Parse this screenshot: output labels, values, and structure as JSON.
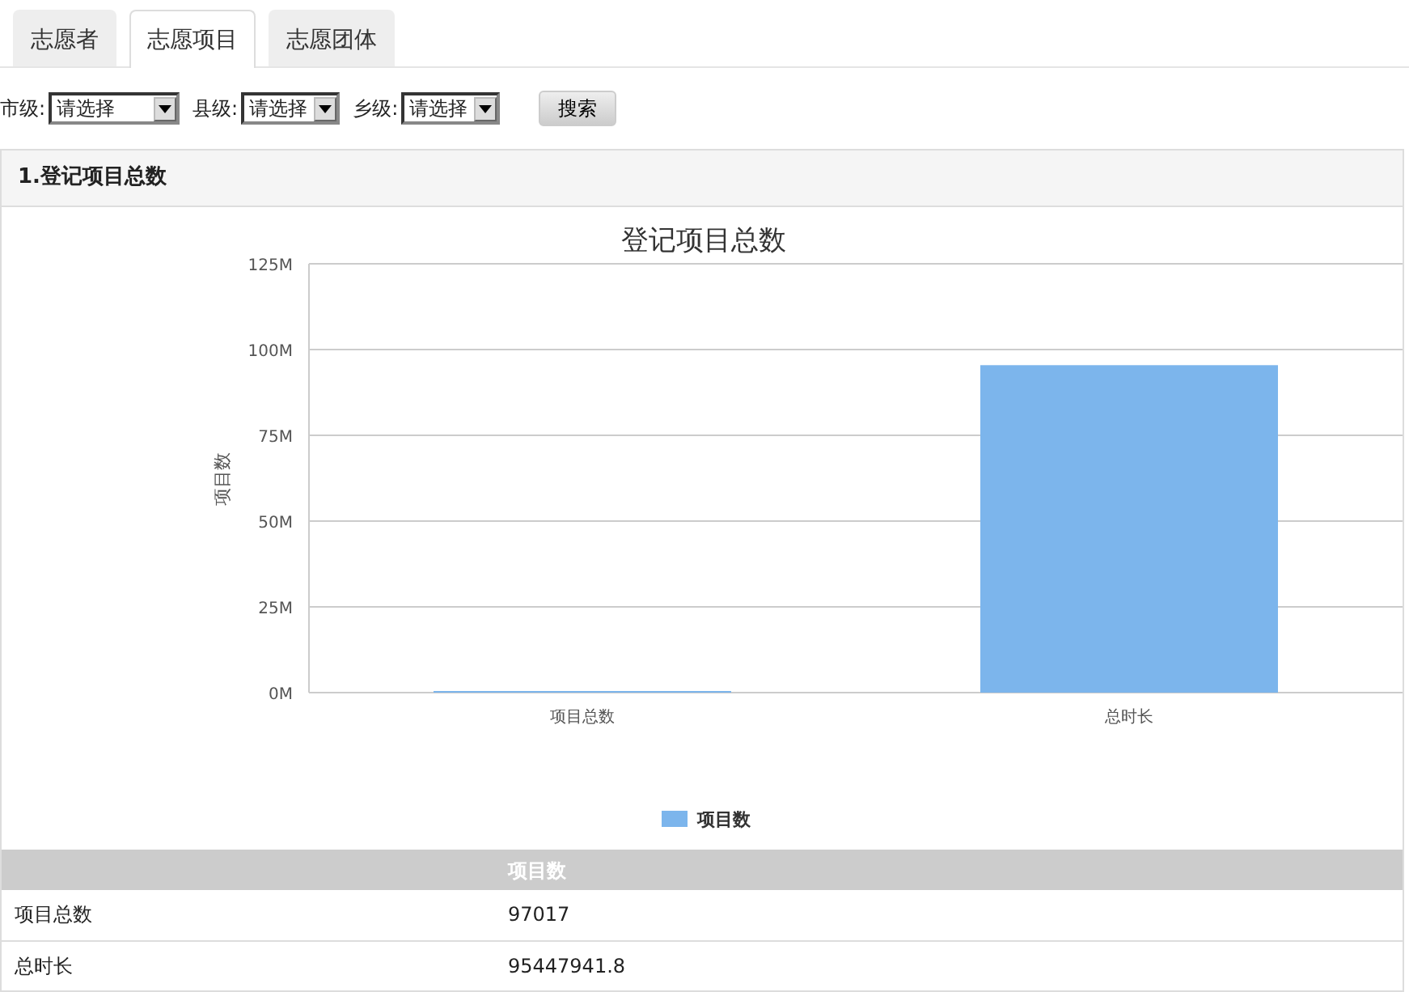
{
  "tabs": [
    {
      "label": "志愿者",
      "selected": false
    },
    {
      "label": "志愿项目",
      "selected": true
    },
    {
      "label": "志愿团体",
      "selected": false
    }
  ],
  "filters": [
    {
      "label": "市级:",
      "value": "请选择"
    },
    {
      "label": "县级:",
      "value": "请选择"
    },
    {
      "label": "乡级:",
      "value": "请选择"
    }
  ],
  "search_button": "搜索",
  "panel": {
    "title": "1.登记项目总数",
    "chart_data": {
      "type": "bar",
      "title": "登记项目总数",
      "ylabel": "项目数",
      "categories": [
        "项目总数",
        "总时长"
      ],
      "series": [
        {
          "name": "项目数",
          "color": "#7cb5ec",
          "values": [
            97017,
            95447941.8
          ]
        }
      ],
      "ylim": [
        0,
        125000000
      ],
      "grid": true,
      "yticks": [
        {
          "value": 0,
          "label": "0M"
        },
        {
          "value": 25000000,
          "label": "25M"
        },
        {
          "value": 50000000,
          "label": "50M"
        },
        {
          "value": 75000000,
          "label": "75M"
        },
        {
          "value": 100000000,
          "label": "100M"
        },
        {
          "value": 125000000,
          "label": "125M"
        }
      ]
    },
    "table": {
      "columns": [
        "项目数"
      ],
      "rows": [
        {
          "label": "项目总数",
          "value": "97017"
        },
        {
          "label": "总时长",
          "value": "95447941.8"
        }
      ]
    }
  }
}
